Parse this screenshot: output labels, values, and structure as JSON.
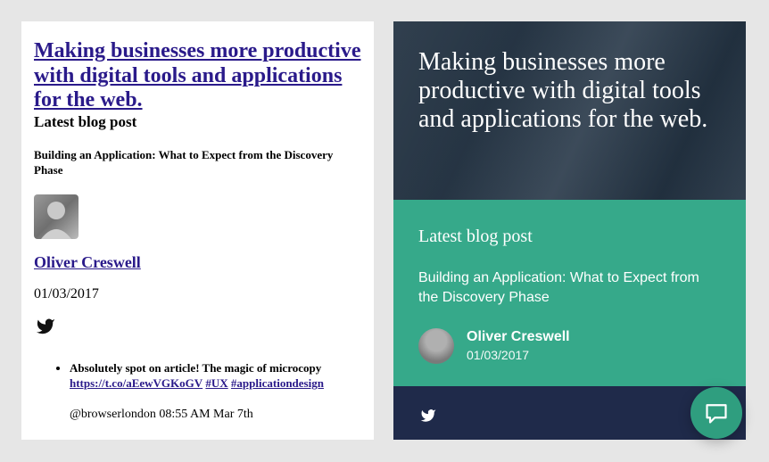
{
  "left": {
    "headline": "Making businesses more productive with digital tools and applications for the web.",
    "latest_label": "Latest blog post",
    "post_title": "Building an Application: What to Expect from the Discovery Phase",
    "author": "Oliver Creswell",
    "date": "01/03/2017",
    "tweet": {
      "text": "Absolutely spot on article! The magic of microcopy",
      "link": "https://t.co/aEewVGKoGV",
      "hashtag1": "#UX",
      "hashtag2": "#applicationdesign",
      "handle_line": "@browserlondon 08:55 AM Mar 7th"
    }
  },
  "right": {
    "headline": "Making businesses more productive with digital tools and applications for the web.",
    "latest_label": "Latest blog post",
    "post_title": "Building an Application: What to Expect from the Discovery Phase",
    "author": "Oliver Creswell",
    "date": "01/03/2017"
  }
}
